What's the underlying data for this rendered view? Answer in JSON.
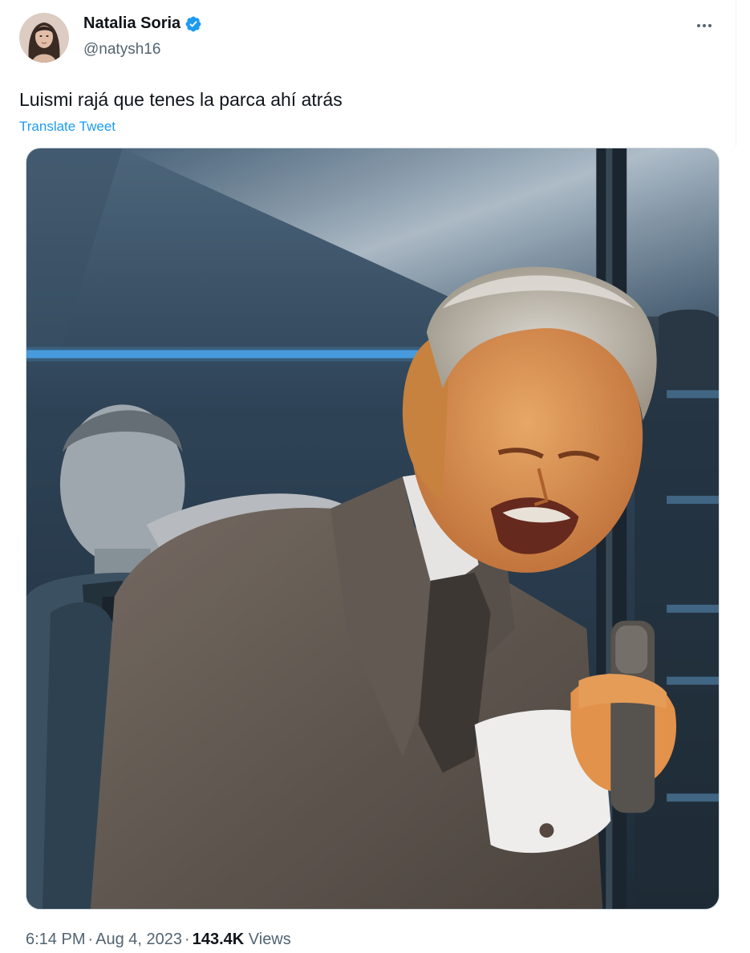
{
  "tweet": {
    "author": {
      "display_name": "Natalia Soria",
      "handle": "@natysh16",
      "verified": true,
      "avatar_icon": "avatar-photo"
    },
    "more_icon": "more-horizontal-icon",
    "text": "Luismi rajá que tenes la parca ahí atrás",
    "translate_label": "Translate Tweet",
    "media": {
      "type": "video-still",
      "icon": "media-photo"
    },
    "meta": {
      "time": "6:14 PM",
      "separator": "·",
      "date": "Aug 4, 2023",
      "views_count": "143.4K",
      "views_label": "Views"
    }
  },
  "colors": {
    "accent": "#1d9bf0",
    "text_primary": "#0f1419",
    "text_secondary": "#536471",
    "border": "#cfd9de"
  }
}
